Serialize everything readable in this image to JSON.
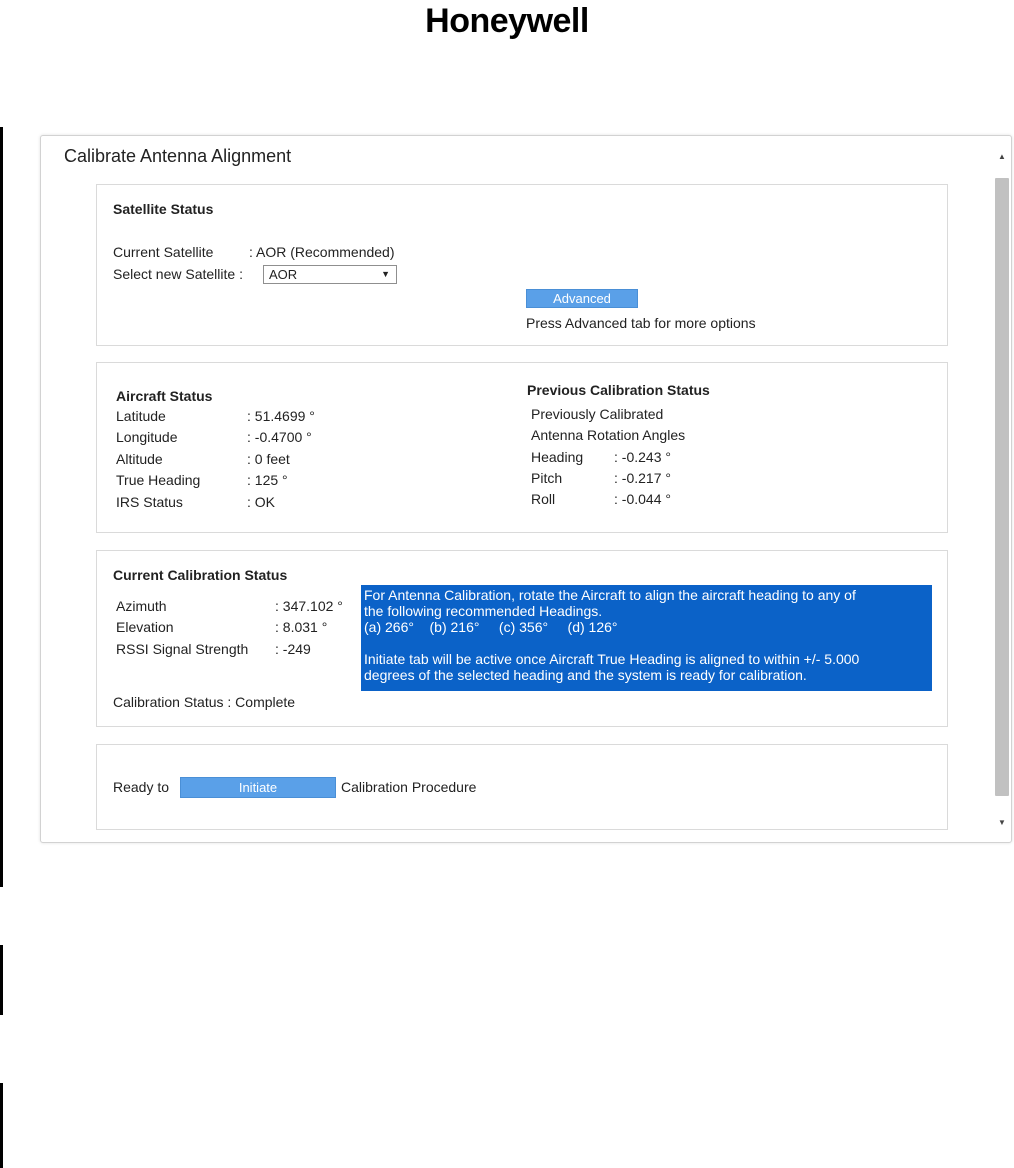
{
  "brand": {
    "logo_text": "Honeywell"
  },
  "window": {
    "title": "Calibrate Antenna Alignment"
  },
  "satellite_status": {
    "heading": "Satellite Status",
    "current_label": "Current Satellite",
    "current_value": ": AOR (Recommended)",
    "select_label": "Select new Satellite :",
    "select_value": "AOR",
    "advanced_button": "Advanced",
    "advanced_hint": "Press Advanced tab for more options"
  },
  "aircraft_status": {
    "heading": "Aircraft Status",
    "rows": [
      {
        "label": "Latitude",
        "value": ": 51.4699 °"
      },
      {
        "label": "Longitude",
        "value": ": -0.4700 °"
      },
      {
        "label": "Altitude",
        "value": ": 0 feet"
      },
      {
        "label": "True Heading",
        "value": ": 125 °"
      },
      {
        "label": "IRS Status",
        "value": ": OK"
      }
    ]
  },
  "previous_calibration": {
    "heading": "Previous Calibration Status",
    "line1": "Previously Calibrated",
    "line2": "Antenna Rotation Angles",
    "rows": [
      {
        "label": "Heading",
        "value": ": -0.243 °"
      },
      {
        "label": "Pitch",
        "value": ": -0.217 °"
      },
      {
        "label": "Roll",
        "value": ": -0.044 °"
      }
    ]
  },
  "current_calibration": {
    "heading": "Current Calibration Status",
    "rows": [
      {
        "label": "Azimuth",
        "value": ": 347.102 °"
      },
      {
        "label": "Elevation",
        "value": ": 8.031 °"
      },
      {
        "label": "RSSI Signal Strength",
        "value": ": -249"
      }
    ],
    "status_text": "Calibration Status : Complete",
    "info": {
      "line1": "For Antenna Calibration, rotate the Aircraft to align the aircraft heading to any of",
      "line2": "the following recommended Headings.",
      "line3": "(a) 266°    (b) 216°     (c) 356°     (d) 126°",
      "line4": "Initiate tab will be active once Aircraft True Heading is aligned to within +/- 5.000",
      "line5": "degrees of the selected heading and the system is ready for calibration."
    }
  },
  "initiate": {
    "prefix": "Ready to",
    "button": "Initiate",
    "suffix": "Calibration Procedure"
  },
  "icons": {
    "scroll_up": "triangle-up",
    "scroll_down": "triangle-down",
    "select_arrow": "triangle-down"
  }
}
